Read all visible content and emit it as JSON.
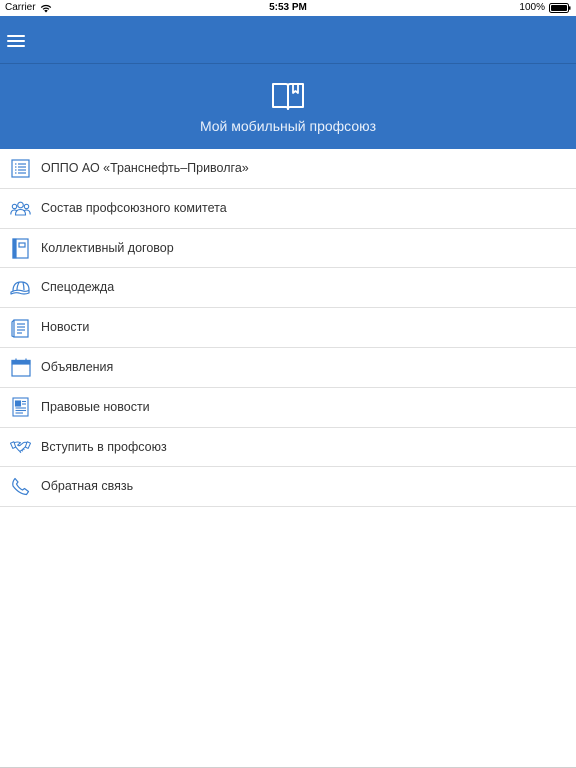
{
  "status_bar": {
    "carrier": "Carrier",
    "time": "5:53 PM",
    "battery": "100%"
  },
  "header": {
    "title": "Мой мобильный профсоюз"
  },
  "colors": {
    "primary": "#3373c3",
    "icon": "#3b7fd0",
    "text": "#333333",
    "divider": "#e0e0e0"
  },
  "menu": {
    "items": [
      {
        "label": "ОППО АО «Транснефть–Приволга»",
        "icon": "list-icon"
      },
      {
        "label": "Состав профсоюзного комитета",
        "icon": "group-icon"
      },
      {
        "label": "Коллективный договор",
        "icon": "notebook-icon"
      },
      {
        "label": "Спецодежда",
        "icon": "hard-hat-icon"
      },
      {
        "label": "Новости",
        "icon": "document-icon"
      },
      {
        "label": "Объявления",
        "icon": "calendar-icon"
      },
      {
        "label": "Правовые новости",
        "icon": "newspaper-icon"
      },
      {
        "label": "Вступить в профсоюз",
        "icon": "handshake-icon"
      },
      {
        "label": "Обратная связь",
        "icon": "phone-icon"
      }
    ]
  }
}
